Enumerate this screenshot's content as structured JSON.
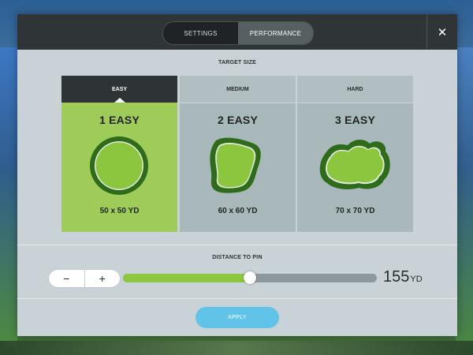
{
  "tabs": [
    {
      "label": "SETTINGS",
      "active": false
    },
    {
      "label": "PERFORMANCE",
      "active": true
    }
  ],
  "close_icon": "close-icon",
  "target_size": {
    "label": "TARGET SIZE",
    "options": [
      {
        "difficulty": "EASY",
        "title": "1 EASY",
        "size": "50 x 50 YD",
        "selected": true
      },
      {
        "difficulty": "MEDIUM",
        "title": "2 EASY",
        "size": "60 x 60 YD",
        "selected": false
      },
      {
        "difficulty": "HARD",
        "title": "3 EASY",
        "size": "70 x 70 YD",
        "selected": false
      }
    ]
  },
  "distance_to_pin": {
    "label": "DISTANCE TO PIN",
    "minus_label": "−",
    "plus_label": "+",
    "value": "155",
    "unit": "YD",
    "slider_fraction": 0.5
  },
  "apply_label": "APPLY",
  "colors": {
    "accent_green": "#8dc63f",
    "selected_card": "#9fcb58",
    "green_dark": "#2e6b1a",
    "green_light": "#8cc63f",
    "apply_blue": "#62c3e8",
    "header_dark": "#2f3436"
  }
}
